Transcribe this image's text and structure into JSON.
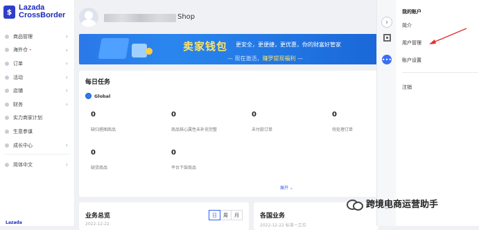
{
  "brand": {
    "line1": "Lazada",
    "line2": "CrossBorder",
    "badge": "$",
    "bottom": "Lazada"
  },
  "sidebar": {
    "items": [
      {
        "label": "商品管理",
        "chevron": true
      },
      {
        "label": "海外仓",
        "chevron": true,
        "dot": "•"
      },
      {
        "label": "订单",
        "chevron": true
      },
      {
        "label": "活动",
        "chevron": true
      },
      {
        "label": "店铺",
        "chevron": true
      },
      {
        "label": "财务",
        "chevron": true
      },
      {
        "label": "实力商家计划",
        "chevron": false
      },
      {
        "label": "生意参谋",
        "chevron": false
      },
      {
        "label": "成长中心",
        "chevron": true
      }
    ],
    "language": {
      "label": "简体中文"
    }
  },
  "header": {
    "shop_suffix": "Shop"
  },
  "banner": {
    "title": "卖家钱包",
    "tagline": "更安全，更便捷，更优惠，你的财富好管家",
    "sub_prefix": "— 现在激活，",
    "sub_highlight": "赚罗提现福利",
    "sub_suffix": " —"
  },
  "tasks": {
    "title": "每日任务",
    "region": "Global",
    "stats": [
      {
        "value": "0",
        "label": "缺归搭图商品"
      },
      {
        "value": "0",
        "label": "商品核心属性未补充完整"
      },
      {
        "value": "0",
        "label": "未付款订单"
      },
      {
        "value": "0",
        "label": "待处理订单"
      },
      {
        "value": "0",
        "label": "缺货商品"
      },
      {
        "value": "0",
        "label": "平台下架商品"
      }
    ],
    "expand": "展开 ⌄"
  },
  "business": {
    "title": "业务总览",
    "date": "2022-12-22",
    "tabs": [
      "日",
      "周",
      "月"
    ],
    "active_tab": "日"
  },
  "sites": {
    "title": "各国业务",
    "date": "2022-12-22   标准一工位"
  },
  "rail": {
    "collapse_icon": "chevron-right-icon",
    "qr_icon": "qr-code-icon",
    "chat_icon": "chat-icon",
    "chat_glyph": "•••"
  },
  "account_menu": {
    "heading": "我的账户",
    "items": [
      "简介",
      "用户管理",
      "账户设置"
    ],
    "logout": "注销"
  },
  "watermark": {
    "text": "跨境电商运营助手"
  },
  "colors": {
    "brand": "#1c2bb8",
    "accent": "#2f5ff0",
    "annotation_arrow": "#e03030",
    "banner_gold": "#ffe566"
  }
}
